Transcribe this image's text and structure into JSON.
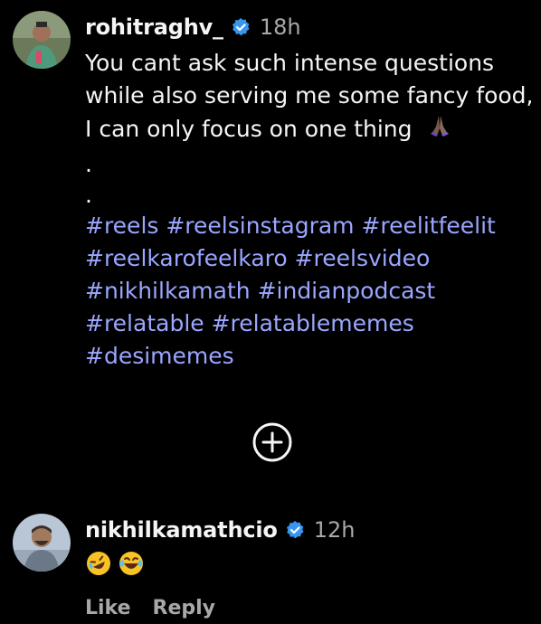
{
  "comment1": {
    "username": "rohitraghv_",
    "time": "18h",
    "caption_lines": [
      "You cant ask such intense questions",
      "while also serving me some fancy food,",
      "I can only focus on one thing"
    ],
    "dots": [
      ".",
      "."
    ],
    "hashtag_lines": [
      "#reels #reelsinstagram #reelitfeelit",
      "#reelkarofeelkaro #reelsvideo",
      "#nikhilkamath #indianpodcast",
      "#relatable #relatablememes",
      "#desimemes"
    ],
    "emoji_icon": "folded-hands-icon"
  },
  "add_button_icon": "plus-circle-icon",
  "comment2": {
    "username": "nikhilkamathcio",
    "time": "12h",
    "emojis": [
      "rofl-emoji-icon",
      "laughing-emoji-icon"
    ],
    "actions": {
      "like": "Like",
      "reply": "Reply"
    }
  },
  "colors": {
    "background": "#000000",
    "text": "#f5f5f5",
    "muted": "#a8a8a8",
    "hashtag": "#9aa6ff",
    "verified": "#3797f0"
  }
}
